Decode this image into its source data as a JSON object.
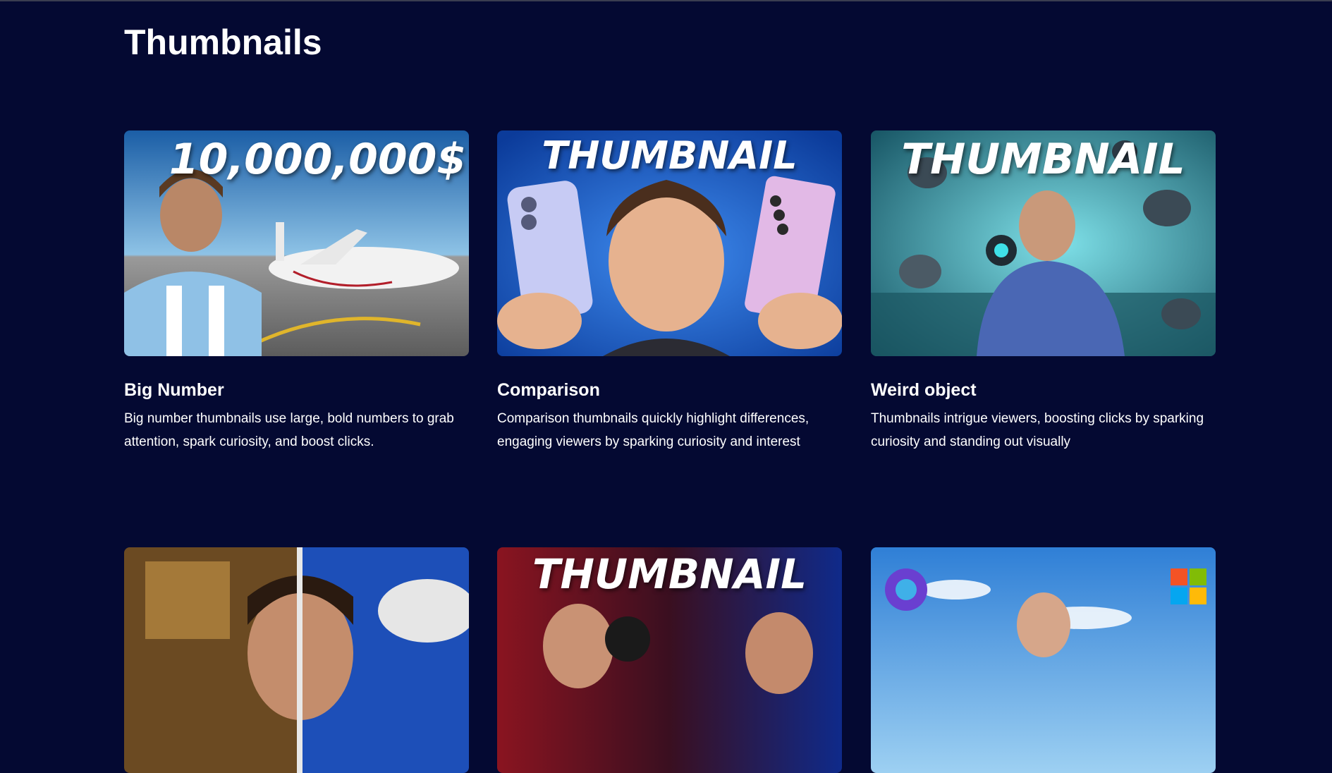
{
  "section": {
    "title": "Thumbnails"
  },
  "cards": [
    {
      "title": "Big Number",
      "description": "Big number thumbnails use large, bold numbers to grab attention, spark curiosity, and boost clicks.",
      "thumbnail_text": "10,000,000$",
      "thumbnail_icon": "private-jet-portrait-image"
    },
    {
      "title": "Comparison",
      "description": "Comparison thumbnails quickly highlight differences, engaging viewers by sparking curiosity and interest",
      "thumbnail_text": "THUMBNAIL",
      "thumbnail_icon": "phone-comparison-image"
    },
    {
      "title": "Weird object",
      "description": "Thumbnails intrigue viewers, boosting clicks by sparking curiosity and standing out visually",
      "thumbnail_text": "THUMBNAIL",
      "thumbnail_icon": "floating-objects-image"
    },
    {
      "title": "",
      "description": "",
      "thumbnail_text": "",
      "thumbnail_icon": "split-face-rocket-image"
    },
    {
      "title": "",
      "description": "",
      "thumbnail_text": "THUMBNAIL",
      "thumbnail_icon": "boxing-match-image"
    },
    {
      "title": "",
      "description": "",
      "thumbnail_text": "",
      "thumbnail_icon": "logos-sky-portrait-image"
    }
  ],
  "colors": {
    "background": "#040932",
    "text": "#ffffff"
  }
}
